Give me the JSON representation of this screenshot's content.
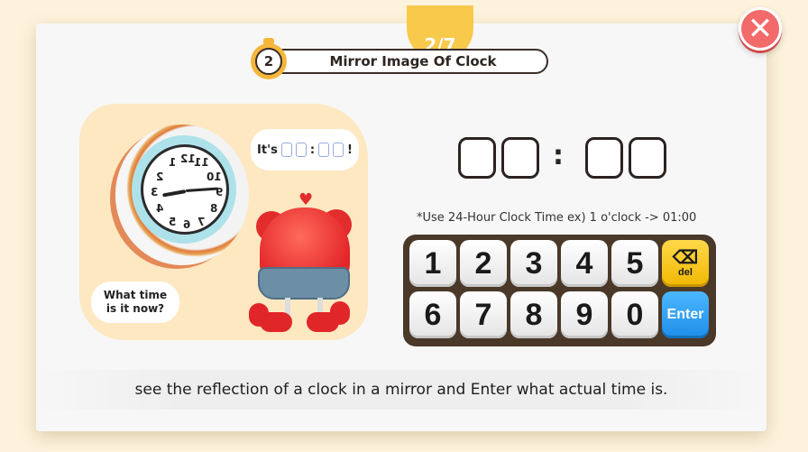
{
  "progress": "2/7",
  "step_number": "2",
  "title": "Mirror Image Of Clock",
  "bubble_question": [
    "What time",
    "is it now?"
  ],
  "bubble_answer": {
    "prefix": "It's",
    "suffix": "!"
  },
  "clock_numbers": [
    "12",
    "1",
    "2",
    "3",
    "4",
    "5",
    "6",
    "7",
    "8",
    "9",
    "10",
    "11"
  ],
  "answer_separator": ":",
  "hint": "*Use 24-Hour Clock Time ex) 1 o'clock -> 01:00",
  "keypad": {
    "row1": [
      "1",
      "2",
      "3",
      "4",
      "5"
    ],
    "row2": [
      "6",
      "7",
      "8",
      "9",
      "0"
    ],
    "del_label": "del",
    "enter_label": "Enter"
  },
  "instruction": "see the reflection of a clock in a mirror and Enter what actual time is.",
  "icons": {
    "close": "close-x-icon",
    "delete": "backspace-icon",
    "step": "stopwatch-icon"
  },
  "colors": {
    "accent": "#f8c94b",
    "close": "#f26a6a",
    "enter": "#1f8ee8",
    "del": "#f0b800"
  }
}
